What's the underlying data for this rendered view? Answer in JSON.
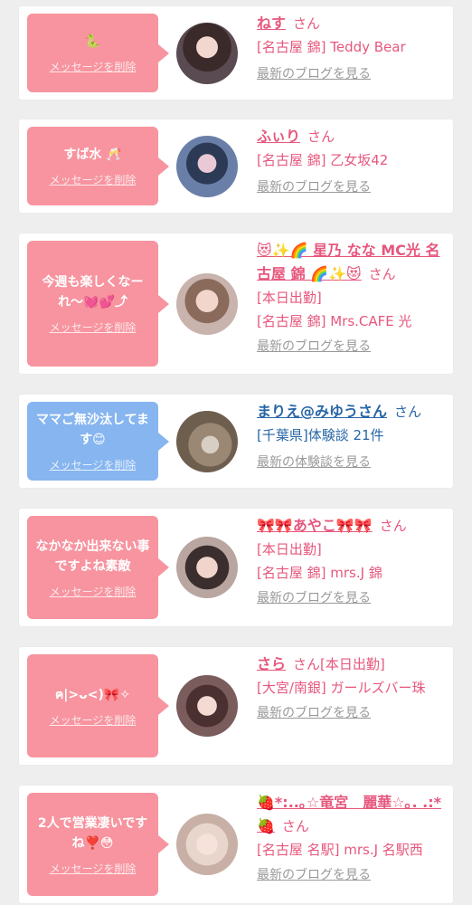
{
  "colors": {
    "accent_pink": "#f7949f",
    "accent_blue": "#86b5ef",
    "name_pink": "#e7577d",
    "name_blue": "#2766a6",
    "link_gray": "#999999"
  },
  "items": [
    {
      "message": "🐍",
      "delete_label": "メッセージを削除",
      "name": "ねす",
      "suffix": "さん",
      "extra": "",
      "lines": [
        "[名古屋 錦] Teddy Bear"
      ],
      "link": "最新のブログを見る"
    },
    {
      "message": "すば水 🥂",
      "delete_label": "メッセージを削除",
      "name": "ふぃり",
      "suffix": "さん",
      "extra": "",
      "lines": [
        "[名古屋 錦] 乙女坂42"
      ],
      "link": "最新のブログを見る"
    },
    {
      "message": "今週も楽しくなーれ〜💓💕⤴︎",
      "delete_label": "メッセージを削除",
      "name": "😻✨🌈 星乃 なな MC光 名古屋 錦 🌈✨😻",
      "suffix": "さん",
      "extra": "",
      "lines": [
        "[本日出勤]",
        "[名古屋 錦] Mrs.CAFE 光"
      ],
      "link": "最新のブログを見る"
    },
    {
      "message": "ママご無沙汰してます😊",
      "delete_label": "メッセージを削除",
      "name": "まりえ@みゆうさん",
      "suffix": "さん",
      "extra": "",
      "lines": [
        "[千葉県]体験談 21件"
      ],
      "link": "最新の体験談を見る"
    },
    {
      "message": "なかなか出来ない事ですよね素敵",
      "delete_label": "メッセージを削除",
      "name": "🎀🎀あやこ🎀🎀",
      "suffix": "さん",
      "extra": "",
      "lines": [
        "[本日出勤]",
        "[名古屋 錦] mrs.J 錦"
      ],
      "link": "最新のブログを見る"
    },
    {
      "message": "ฅ|>ᴗ<)🎀✧",
      "delete_label": "メッセージを削除",
      "name": "さら",
      "suffix": "さん",
      "extra": "[本日出勤]",
      "lines": [
        "[大宮/南銀] ガールズバー珠"
      ],
      "link": "最新のブログを見る"
    },
    {
      "message": "2人で営業凄いですね❣️😳",
      "delete_label": "メッセージを削除",
      "name": "🍓*:..｡☆竜宮　麗華☆｡. .:*🍓",
      "suffix": "さん",
      "extra": "",
      "lines": [
        "[名古屋 名駅] mrs.J 名駅西"
      ],
      "link": "最新のブログを見る"
    }
  ]
}
